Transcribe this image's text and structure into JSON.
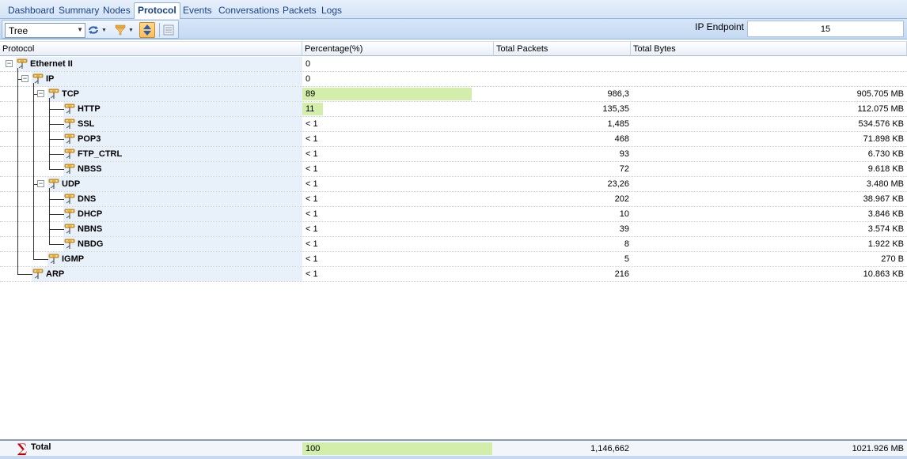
{
  "tabs": [
    {
      "label": "Dashboard",
      "active": false
    },
    {
      "label": "Summary",
      "active": false
    },
    {
      "label": "Nodes",
      "active": false
    },
    {
      "label": "Protocol",
      "active": true
    },
    {
      "label": "Events",
      "active": false
    },
    {
      "label": "Conversations",
      "active": false
    },
    {
      "label": "Packets",
      "active": false
    },
    {
      "label": "Logs",
      "active": false
    }
  ],
  "toolbar": {
    "view_mode": "Tree",
    "endpoint_label": "IP Endpoint",
    "endpoint_value": "15",
    "icons": [
      "refresh-icon",
      "filter-icon",
      "sort-icon",
      "grid-view-icon"
    ]
  },
  "columns": {
    "protocol": "Protocol",
    "percentage": "Percentage(%)",
    "total_packets": "Total Packets",
    "total_bytes": "Total Bytes"
  },
  "rows": [
    {
      "name": "Ethernet II",
      "level": 0,
      "expandable": true,
      "percentage": "0",
      "pct_fill": 0,
      "packets": "",
      "bytes": ""
    },
    {
      "name": "IP",
      "level": 1,
      "expandable": true,
      "percentage": "0",
      "pct_fill": 0,
      "packets": "",
      "bytes": ""
    },
    {
      "name": "TCP",
      "level": 2,
      "expandable": true,
      "percentage": "89",
      "pct_fill": 89,
      "packets": "986,3",
      "bytes": "905.705 MB"
    },
    {
      "name": "HTTP",
      "level": 3,
      "expandable": false,
      "percentage": "11",
      "pct_fill": 11,
      "packets": "135,35",
      "bytes": "112.075 MB"
    },
    {
      "name": "SSL",
      "level": 3,
      "expandable": false,
      "percentage": "< 1",
      "pct_fill": 0,
      "packets": "1,485",
      "bytes": "534.576 KB"
    },
    {
      "name": "POP3",
      "level": 3,
      "expandable": false,
      "percentage": "< 1",
      "pct_fill": 0,
      "packets": "468",
      "bytes": "71.898 KB"
    },
    {
      "name": "FTP_CTRL",
      "level": 3,
      "expandable": false,
      "percentage": "< 1",
      "pct_fill": 0,
      "packets": "93",
      "bytes": "6.730 KB"
    },
    {
      "name": "NBSS",
      "level": 3,
      "expandable": false,
      "percentage": "< 1",
      "pct_fill": 0,
      "packets": "72",
      "bytes": "9.618 KB"
    },
    {
      "name": "UDP",
      "level": 2,
      "expandable": true,
      "percentage": "< 1",
      "pct_fill": 0,
      "packets": "23,26",
      "bytes": "3.480 MB"
    },
    {
      "name": "DNS",
      "level": 3,
      "expandable": false,
      "percentage": "< 1",
      "pct_fill": 0,
      "packets": "202",
      "bytes": "38.967 KB"
    },
    {
      "name": "DHCP",
      "level": 3,
      "expandable": false,
      "percentage": "< 1",
      "pct_fill": 0,
      "packets": "10",
      "bytes": "3.846 KB"
    },
    {
      "name": "NBNS",
      "level": 3,
      "expandable": false,
      "percentage": "< 1",
      "pct_fill": 0,
      "packets": "39",
      "bytes": "3.574 KB"
    },
    {
      "name": "NBDG",
      "level": 3,
      "expandable": false,
      "percentage": "< 1",
      "pct_fill": 0,
      "packets": "8",
      "bytes": "1.922 KB"
    },
    {
      "name": "IGMP",
      "level": 2,
      "expandable": false,
      "percentage": "< 1",
      "pct_fill": 0,
      "packets": "5",
      "bytes": "270 B"
    },
    {
      "name": "ARP",
      "level": 1,
      "expandable": false,
      "percentage": "< 1",
      "pct_fill": 0,
      "packets": "216",
      "bytes": "10.863 KB"
    }
  ],
  "total": {
    "label": "Total",
    "percentage": "100",
    "pct_fill": 100,
    "packets": "1,146,662",
    "bytes": "1021.926 MB"
  },
  "colors": {
    "bar_fill": "#d3eeaa",
    "accent": "#15428b",
    "sigma": "#c00000"
  }
}
